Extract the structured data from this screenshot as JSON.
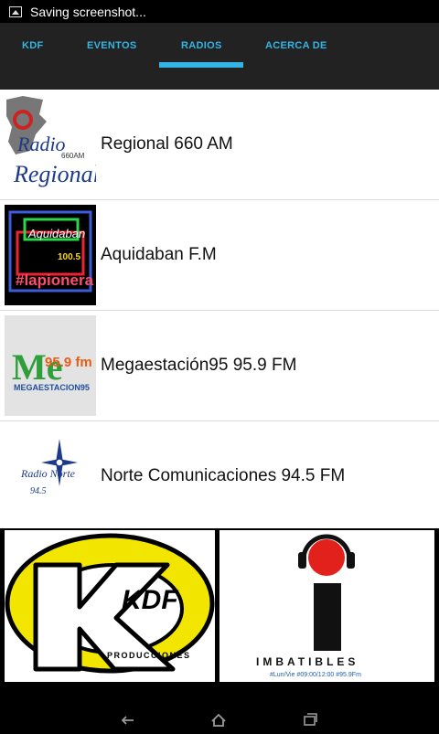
{
  "status_bar": {
    "notification": "Saving screenshot..."
  },
  "tabs": [
    {
      "label": "KDF"
    },
    {
      "label": "EVENTOS"
    },
    {
      "label": "RADIOS",
      "selected": true
    },
    {
      "label": "ACERCA DE"
    }
  ],
  "radios": [
    {
      "name": "Regional 660 AM",
      "logo": {
        "line1": "Radio",
        "line2": "Regional",
        "freq": "660AM"
      }
    },
    {
      "name": "Aquidaban F.M",
      "logo": {
        "top": "Aquidaban",
        "freq": "100.5",
        "tag": "#lapionera"
      }
    },
    {
      "name": "Megaestación95 95.9 FM",
      "logo": {
        "mark": "Me",
        "freq": "95.9 fm",
        "sub": "MEGAESTACION95"
      }
    },
    {
      "name": "Norte Comunicaciones 94.5 FM",
      "logo": {
        "text": "Radio Norte",
        "freq": "94.5"
      }
    }
  ],
  "tiles": [
    {
      "logo_text": "KDF",
      "sub": "PRODUCCIONES"
    },
    {
      "title": "IMBATIBLES",
      "schedule": "#Lun/Vie #09:00/12:00 #95.9Fm"
    }
  ],
  "colors": {
    "accent": "#33b5e5",
    "tab_bar": "#222222",
    "list_bg": "#ffffff",
    "kdf_yellow": "#f2e600",
    "imbatibles_red": "#e3211c",
    "mega_green": "#2f9f3c",
    "mega_blue": "#1f4f9c"
  },
  "nav": {
    "back": "back-icon",
    "home": "home-icon",
    "recents": "recents-icon"
  }
}
